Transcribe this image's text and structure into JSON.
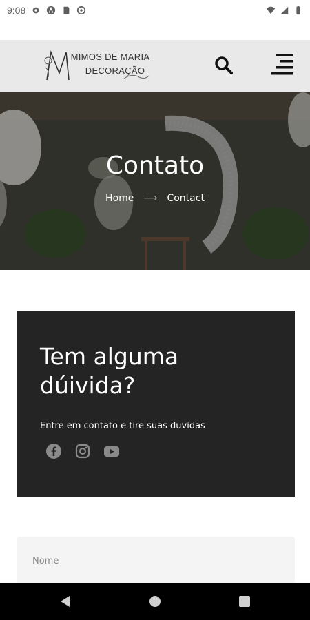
{
  "status_bar": {
    "time": "9:08"
  },
  "header": {
    "logo_line1": "MIMOS DE MARIA",
    "logo_line2": "DECORAÇÃO"
  },
  "hero": {
    "title": "Contato",
    "breadcrumb": {
      "home": "Home",
      "separator": "⟶",
      "current": "Contact"
    }
  },
  "contact_card": {
    "title_line1": "Tem alguma",
    "title_line2": "dúivida?",
    "subtitle": "Entre em contato e tire suas duvidas",
    "socials": [
      "facebook-icon",
      "instagram-icon",
      "youtube-icon"
    ]
  },
  "form": {
    "name_placeholder": "Nome"
  },
  "colors": {
    "header_bg": "#e9e9e9",
    "card_bg": "#242424",
    "field_bg": "#f4f4f4",
    "social_icon": "#8a8a8a"
  }
}
